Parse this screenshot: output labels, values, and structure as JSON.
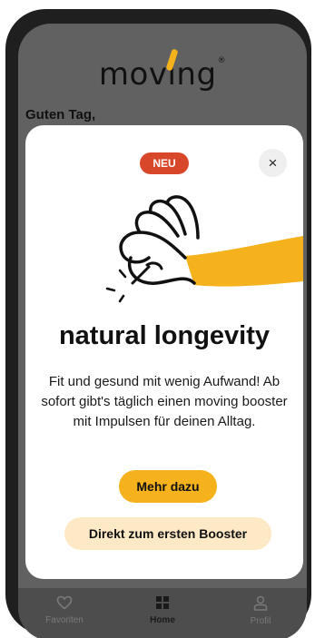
{
  "app": {
    "logo_text_before": "mov",
    "logo_text_i": "i",
    "logo_text_after": "ng",
    "logo_mark": "®",
    "greeting": "Guten Tag,"
  },
  "modal": {
    "badge": "NEU",
    "close_label": "×",
    "title": "natural longevity",
    "description": "Fit und gesund mit wenig Aufwand! Ab sofort gibt's täglich einen moving booster mit Impulsen für deinen Alltag.",
    "primary_button": "Mehr dazu",
    "secondary_button": "Direkt zum ersten Booster",
    "illustration": "hand-snap-icon"
  },
  "tabbar": {
    "items": [
      {
        "label": "Favoriten",
        "icon": "heart-icon",
        "active": false
      },
      {
        "label": "Home",
        "icon": "grid-icon",
        "active": true
      },
      {
        "label": "Profil",
        "icon": "person-icon",
        "active": false
      }
    ]
  },
  "colors": {
    "accent": "#f6b21c",
    "badge": "#d9472b",
    "secondary_button": "#fde9c6",
    "overlay": "#616161"
  }
}
